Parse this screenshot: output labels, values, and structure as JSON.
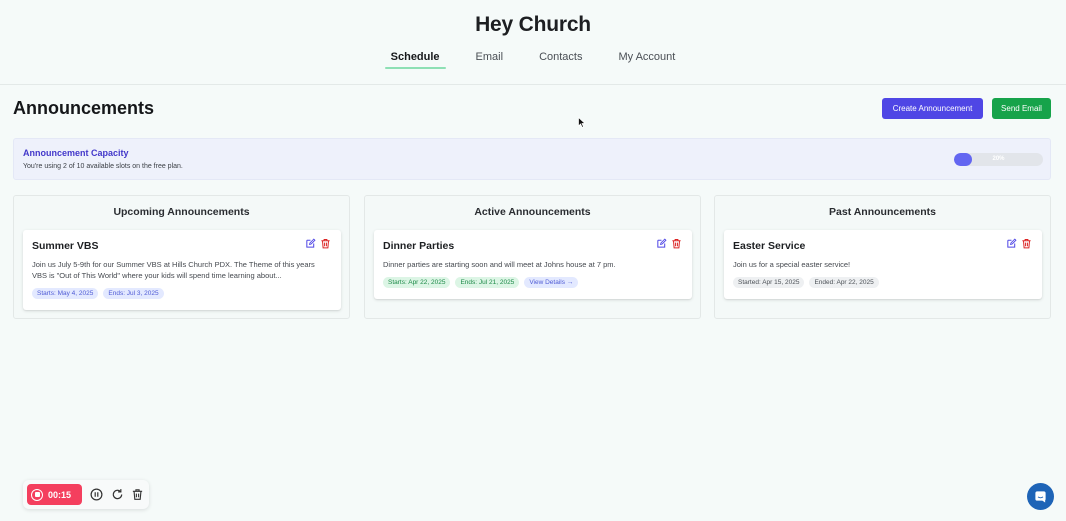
{
  "app": {
    "brand": "Hey Church",
    "nav": [
      {
        "label": "Schedule",
        "active": true
      },
      {
        "label": "Email",
        "active": false
      },
      {
        "label": "Contacts",
        "active": false
      },
      {
        "label": "My Account",
        "active": false
      }
    ]
  },
  "page": {
    "title": "Announcements",
    "create_label": "Create Announcement",
    "send_label": "Send Email"
  },
  "capacity": {
    "title": "Announcement Capacity",
    "subtitle": "You're using 2 of 10 available slots on the free plan.",
    "percent_label": "20%",
    "fraction": 0.2
  },
  "columns": [
    {
      "heading": "Upcoming Announcements",
      "cards": [
        {
          "title": "Summer VBS",
          "description": "Join us July 5-9th for our Summer VBS at Hills Church PDX. The Theme of this years VBS is \"Out of This World\" where your kids will spend time learning about...",
          "chips": [
            {
              "text": "Starts: May 4, 2025",
              "style": "blue"
            },
            {
              "text": "Ends: Jul 3, 2025",
              "style": "blue"
            }
          ]
        }
      ]
    },
    {
      "heading": "Active Announcements",
      "cards": [
        {
          "title": "Dinner Parties",
          "description": "Dinner parties are starting soon and will meet at Johns house at 7 pm.",
          "chips": [
            {
              "text": "Starts: Apr 22, 2025",
              "style": "green"
            },
            {
              "text": "Ends: Jul 21, 2025",
              "style": "green"
            },
            {
              "text": "View Details →",
              "style": "link"
            }
          ]
        }
      ]
    },
    {
      "heading": "Past Announcements",
      "cards": [
        {
          "title": "Easter Service",
          "description": "Join us for a special easter service!",
          "chips": [
            {
              "text": "Started: Apr 15, 2025",
              "style": "gray"
            },
            {
              "text": "Ended: Apr 22, 2025",
              "style": "gray"
            }
          ]
        }
      ]
    }
  ],
  "recorder": {
    "time": "00:15",
    "icons": [
      "stop-icon",
      "pause-icon",
      "restart-icon",
      "trash-icon"
    ]
  },
  "icons": {
    "edit": "edit-icon",
    "delete": "trash-icon",
    "chat": "chat-icon",
    "cursor": "cursor-icon"
  },
  "colors": {
    "primary": "#4f46e5",
    "success": "#16a34a",
    "danger": "#dc2626",
    "recorder": "#f43f5e",
    "chat": "#1e64b7"
  }
}
